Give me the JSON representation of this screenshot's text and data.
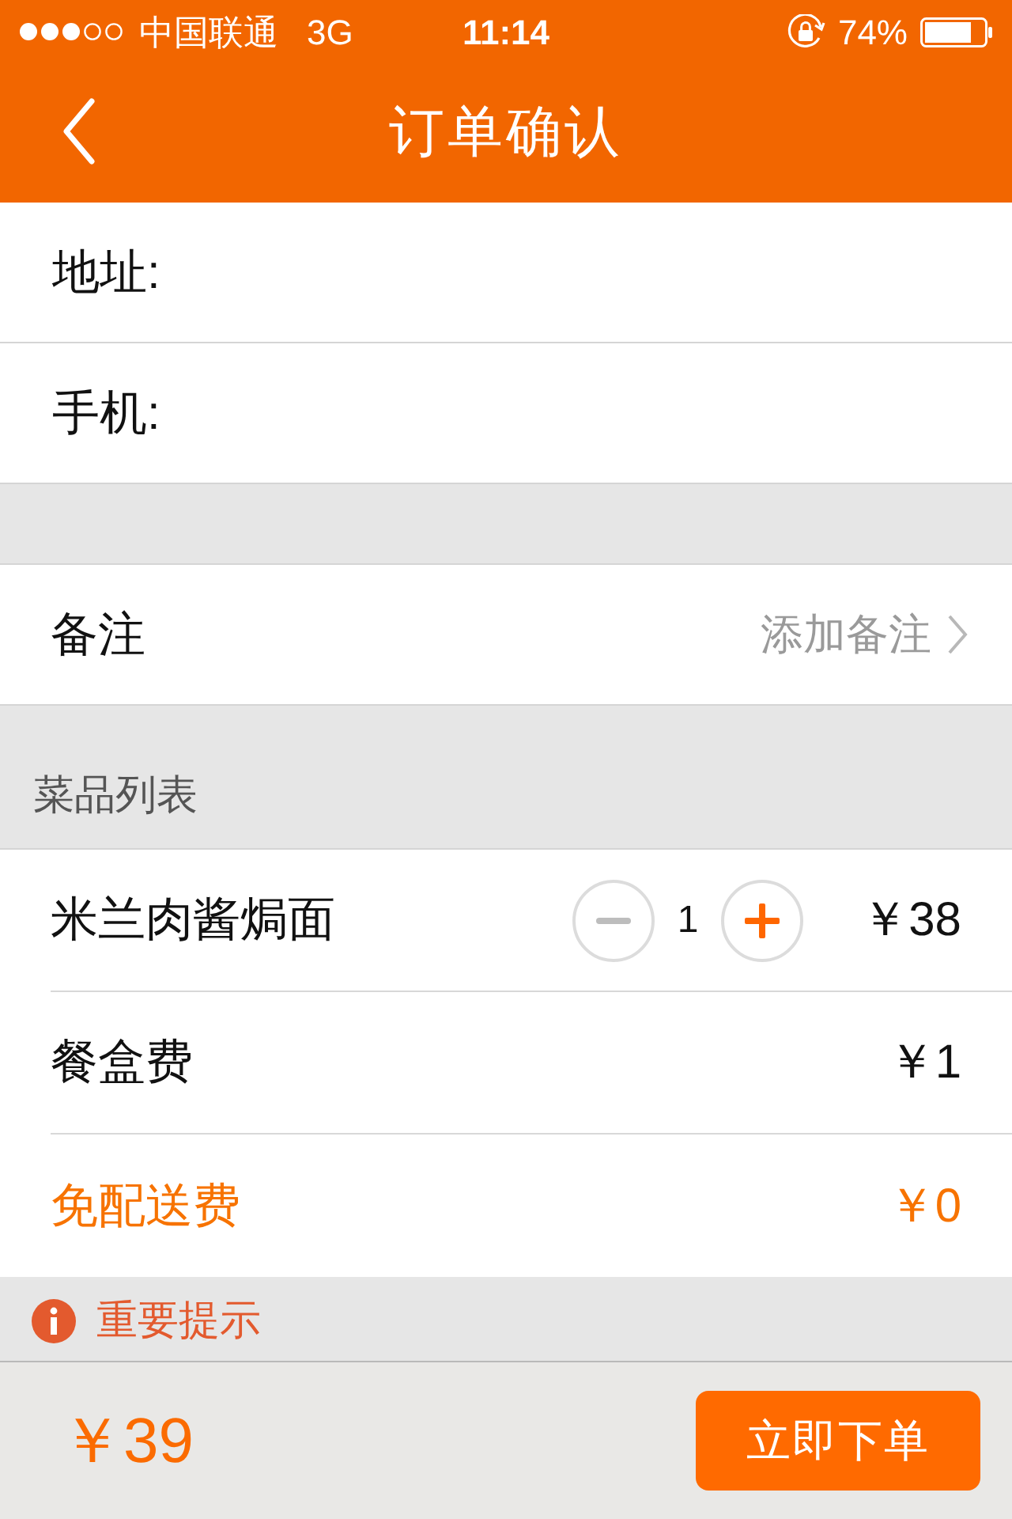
{
  "status_bar": {
    "carrier": "中国联通",
    "network": "3G",
    "time": "11:14",
    "battery": "74%"
  },
  "nav": {
    "title": "订单确认"
  },
  "contact_fields": [
    {
      "label": "地址:"
    },
    {
      "label": "手机:"
    }
  ],
  "remark": {
    "label": "备注",
    "action": "添加备注"
  },
  "dish_list": {
    "title": "菜品列表",
    "items": [
      {
        "kind": "dish",
        "name": "米兰肉酱焗面",
        "quantity": "1",
        "decrease_disabled": true,
        "price": "￥38"
      },
      {
        "kind": "fee",
        "name": "餐盒费",
        "price": "￥1"
      },
      {
        "kind": "free",
        "name": "免配送费",
        "price": "￥0"
      }
    ]
  },
  "notice": {
    "title": "重要提示"
  },
  "footer": {
    "total": "￥39",
    "submit": "立即下单"
  }
}
